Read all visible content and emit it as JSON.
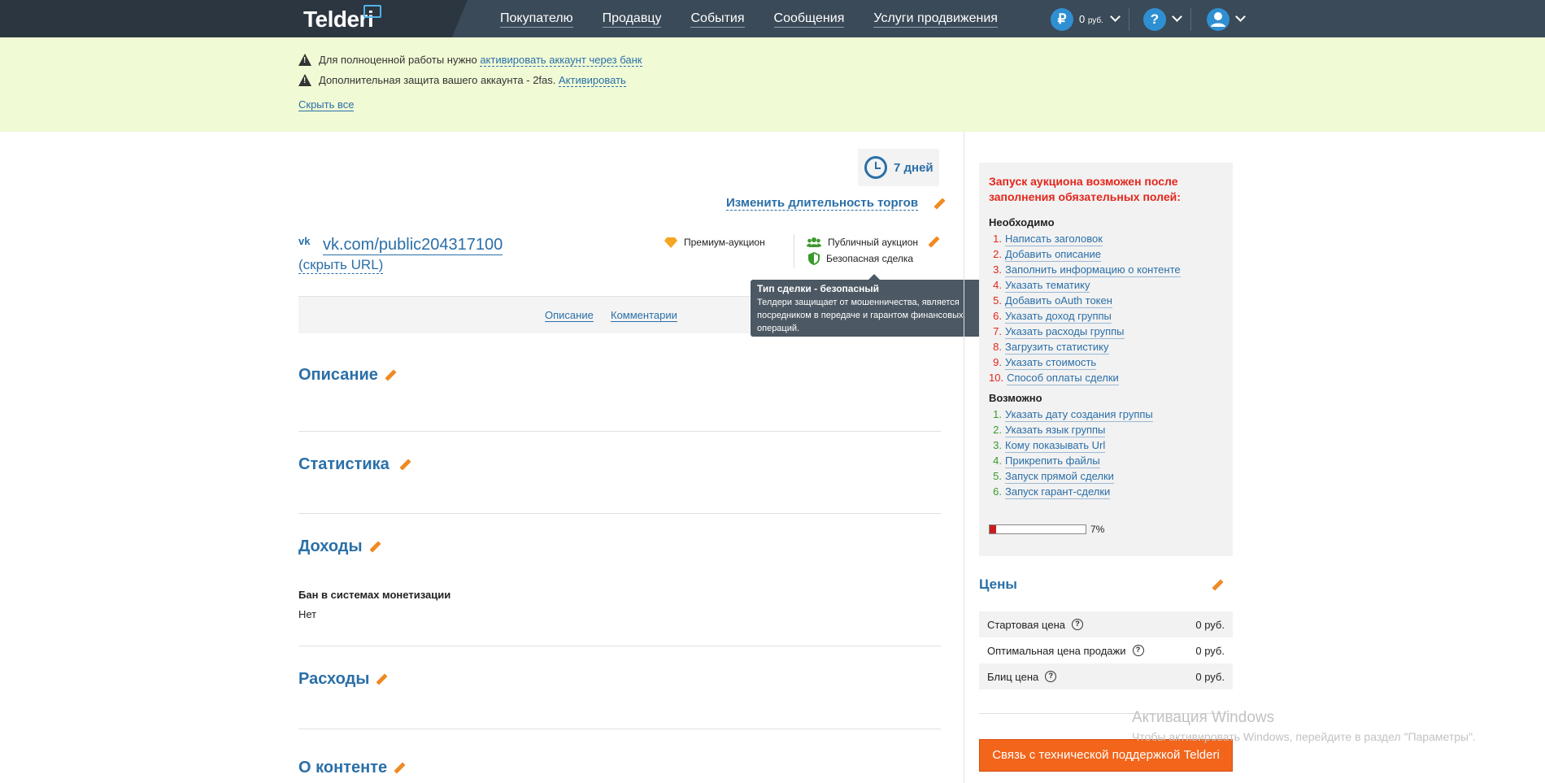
{
  "header": {
    "logo": "Telderi",
    "nav": [
      "Покупателю",
      "Продавцу",
      "События",
      "Сообщения",
      "Услуги продвижения"
    ],
    "balance_icon": "₽",
    "balance": "0",
    "balance_unit": "руб.",
    "help_icon": "?",
    "user_icon": "user-icon"
  },
  "notice": {
    "line1_text": "Для полноценной работы нужно ",
    "line1_link": "активировать аккаунт через банк",
    "line2_text": "Дополнительная защита вашего аккаунта - 2fas. ",
    "line2_link": "Активировать",
    "hide_all": "Скрыть все"
  },
  "auction": {
    "duration": "7 дней",
    "change_duration": "Изменить длительность торгов",
    "vk_icon": "vk",
    "url": "vk.com/public204317100",
    "hide_url": "(скрыть URL)",
    "premium": "Премиум-аукцион",
    "public": "Публичный аукцион",
    "safe_deal": "Безопасная сделка"
  },
  "tooltip": {
    "title": "Тип сделки - безопасный",
    "text": "Телдери защищает от мошенничества, является посредником в передаче и гарантом финансовых операций."
  },
  "tabs": [
    "Описание",
    "Комментарии"
  ],
  "sections": {
    "description": "Описание",
    "statistics": "Статистика",
    "income": "Доходы",
    "ban_label": "Бан в системах монетизации",
    "ban_value": "Нет",
    "expenses": "Расходы",
    "content": "О контенте"
  },
  "requirements": {
    "title": "Запуск аукциона возможен после заполнения обязательных полей:",
    "required_label": "Необходимо",
    "required": [
      {
        "n": "1.",
        "t": "Написать заголовок"
      },
      {
        "n": "2.",
        "t": "Добавить описание"
      },
      {
        "n": "3.",
        "t": "Заполнить информацию о контенте"
      },
      {
        "n": "4.",
        "t": "Указать тематику"
      },
      {
        "n": "5.",
        "t": "Добавить oAuth токен"
      },
      {
        "n": "6.",
        "t": "Указать доход группы"
      },
      {
        "n": "7.",
        "t": "Указать расходы группы"
      },
      {
        "n": "8.",
        "t": "Загрузить статистику"
      },
      {
        "n": "9.",
        "t": "Указать стоимость"
      },
      {
        "n": "10.",
        "t": "Способ оплаты сделки"
      }
    ],
    "optional_label": "Возможно",
    "optional": [
      {
        "n": "1.",
        "t": "Указать дату создания группы"
      },
      {
        "n": "2.",
        "t": "Указать язык группы"
      },
      {
        "n": "3.",
        "t": "Кому показывать Url"
      },
      {
        "n": "4.",
        "t": "Прикрепить файлы"
      },
      {
        "n": "5.",
        "t": "Запуск прямой сделки"
      },
      {
        "n": "6.",
        "t": "Запуск гарант-сделки"
      }
    ],
    "progress_value": 0.07,
    "progress_label": "7%"
  },
  "prices": {
    "title": "Цены",
    "rows": [
      {
        "label": "Стартовая цена",
        "value": "0 руб."
      },
      {
        "label": "Оптимальная цена продажи",
        "value": "0 руб."
      },
      {
        "label": "Блиц цена",
        "value": "0 руб."
      }
    ]
  },
  "support_button": "Связь с технической поддержкой Telderi",
  "windows_watermark": {
    "title": "Активация Windows",
    "subtitle": "Чтобы активировать Windows, перейдите в раздел \"Параметры\"."
  },
  "colors": {
    "accent": "#2a6fa8",
    "warning": "#e4261c",
    "button": "#f2651b",
    "topbar": "#3b4a58"
  }
}
